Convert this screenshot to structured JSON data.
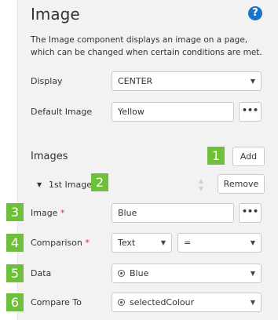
{
  "title": "Image",
  "help_icon": "help-icon",
  "description": "The Image component displays an image on a page, which can be changed when certain conditions are met.",
  "display": {
    "label": "Display",
    "value": "CENTER"
  },
  "default_image": {
    "label": "Default Image",
    "value": "Yellow",
    "more_label": "•••"
  },
  "images_section": {
    "title": "Images",
    "add_label": "Add"
  },
  "first_image": {
    "label": "1st Image",
    "remove_label": "Remove"
  },
  "image_field": {
    "label": "Image",
    "value": "Blue",
    "more_label": "•••"
  },
  "comparison": {
    "label": "Comparison",
    "type_value": "Text",
    "operator_value": "="
  },
  "data_field": {
    "label": "Data",
    "value": "Blue"
  },
  "compare_to": {
    "label": "Compare To",
    "value": "selectedColour"
  },
  "required_mark": "*",
  "badges": [
    "1",
    "2",
    "3",
    "4",
    "5",
    "6"
  ],
  "colors": {
    "badge": "#6ebf3a",
    "help": "#1a73c6",
    "required": "#d9302e",
    "panel": "#f2f2f2"
  }
}
